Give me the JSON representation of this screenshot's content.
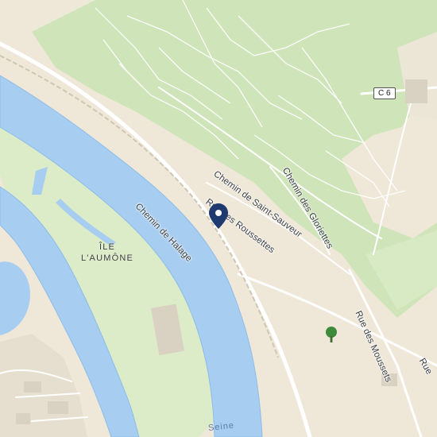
{
  "map": {
    "colors": {
      "land": "#efe8d8",
      "park": "#cfe4b9",
      "park_light": "#dcebc8",
      "water": "#a7cdf0",
      "water_edge": "#8dbde9",
      "road": "#ffffff",
      "marker": "#1f3a6e"
    },
    "labels": {
      "chemin_saint_sauveur": "Chemin de Saint-Sauveur",
      "rue_roussettes": "Rue des Roussettes",
      "chemin_gloriettes": "Chemin des Gloriettes",
      "chemin_halage": "Chemin de Halage",
      "rue_moussets": "Rue des Moussets",
      "rue_partial": "Rue",
      "island_line1": "ÎLE",
      "island_line2": "L'AUMÔNE",
      "river_partial": "Seine",
      "route_shield": "C 6"
    },
    "markers": {
      "location": "map-pin-icon",
      "tree": "tree-icon"
    }
  }
}
